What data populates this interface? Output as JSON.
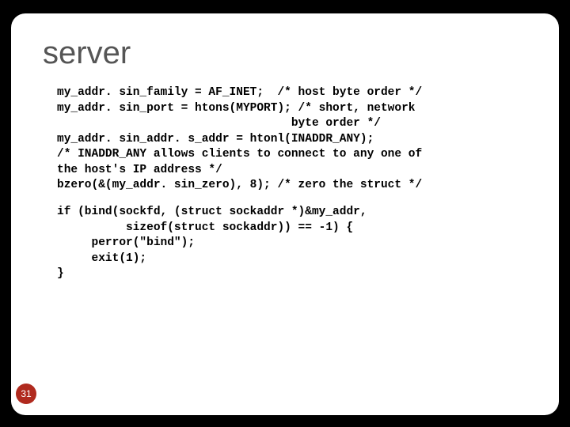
{
  "title": "server",
  "code_block_1": "my_addr. sin_family = AF_INET;  /* host byte order */\nmy_addr. sin_port = htons(MYPORT); /* short, network\n                                  byte order */\nmy_addr. sin_addr. s_addr = htonl(INADDR_ANY);\n/* INADDR_ANY allows clients to connect to any one of\nthe host's IP address */\nbzero(&(my_addr. sin_zero), 8); /* zero the struct */",
  "code_block_2": "if (bind(sockfd, (struct sockaddr *)&my_addr,\n          sizeof(struct sockaddr)) == -1) {\n     perror(\"bind\");\n     exit(1);\n}",
  "page_number": "31"
}
